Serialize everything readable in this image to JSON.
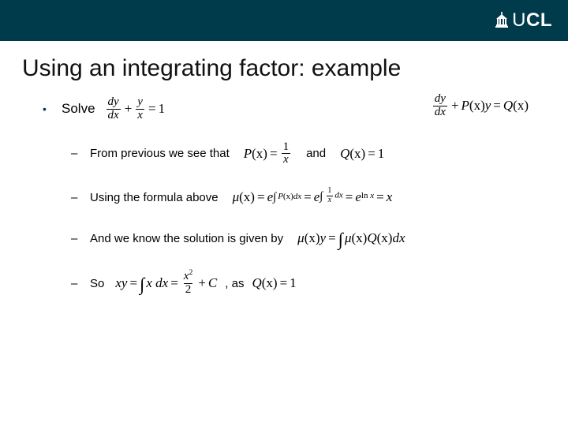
{
  "logo": {
    "text_thin": "U",
    "text_bold": "CL"
  },
  "title": "Using an integrating factor: example",
  "bullet": {
    "label": "Solve"
  },
  "eq_main": {
    "frac1_num": "dy",
    "frac1_den": "dx",
    "plus": "+",
    "frac2_num": "y",
    "frac2_den": "x",
    "eq": "=",
    "rhs": "1"
  },
  "generic": {
    "frac_num": "dy",
    "frac_den": "dx",
    "plus": "+",
    "P": "P",
    "x1": "(x)",
    "y": "y",
    "eq": "=",
    "Q": "Q",
    "x2": "(x)"
  },
  "sub1": {
    "text": "From previous we see that",
    "P": "P",
    "px": "(x)",
    "eq": "=",
    "frac_num": "1",
    "frac_den": "x",
    "and": "and",
    "Q": "Q",
    "qx": "(x)",
    "eq2": "=",
    "one": "1"
  },
  "sub2": {
    "text": "Using the formula above",
    "mu": "μ",
    "mx": "(x)",
    "eq": "=",
    "e": "e",
    "int1": "∫",
    "P": "P",
    "px": "(x)",
    "dx1": "dx",
    "eq2": "=",
    "int2": "∫",
    "frac_num": "1",
    "frac_den": "x",
    "dx2": "dx",
    "eq3": "=",
    "ln": "ln",
    "x": "x",
    "eq4": "=",
    "xfinal": "x"
  },
  "sub3": {
    "text": "And we know the solution is given by",
    "mu": "μ",
    "mx": "(x)",
    "y": "y",
    "eq": "=",
    "int": "∫",
    "mu2": "μ",
    "mx2": "(x)",
    "Q": "Q",
    "qx": "(x)",
    "dx": "dx"
  },
  "sub4": {
    "text": "So",
    "xy": "xy",
    "eq": "=",
    "int": "∫",
    "x": "x",
    "dx": "dx",
    "eq2": "=",
    "frac_num": "x",
    "sq": "2",
    "frac_den": "2",
    "plus": "+",
    "C": "C",
    "comma_as": ", as",
    "Q": "Q",
    "qx": "(x)",
    "eq3": "=",
    "one": "1"
  }
}
